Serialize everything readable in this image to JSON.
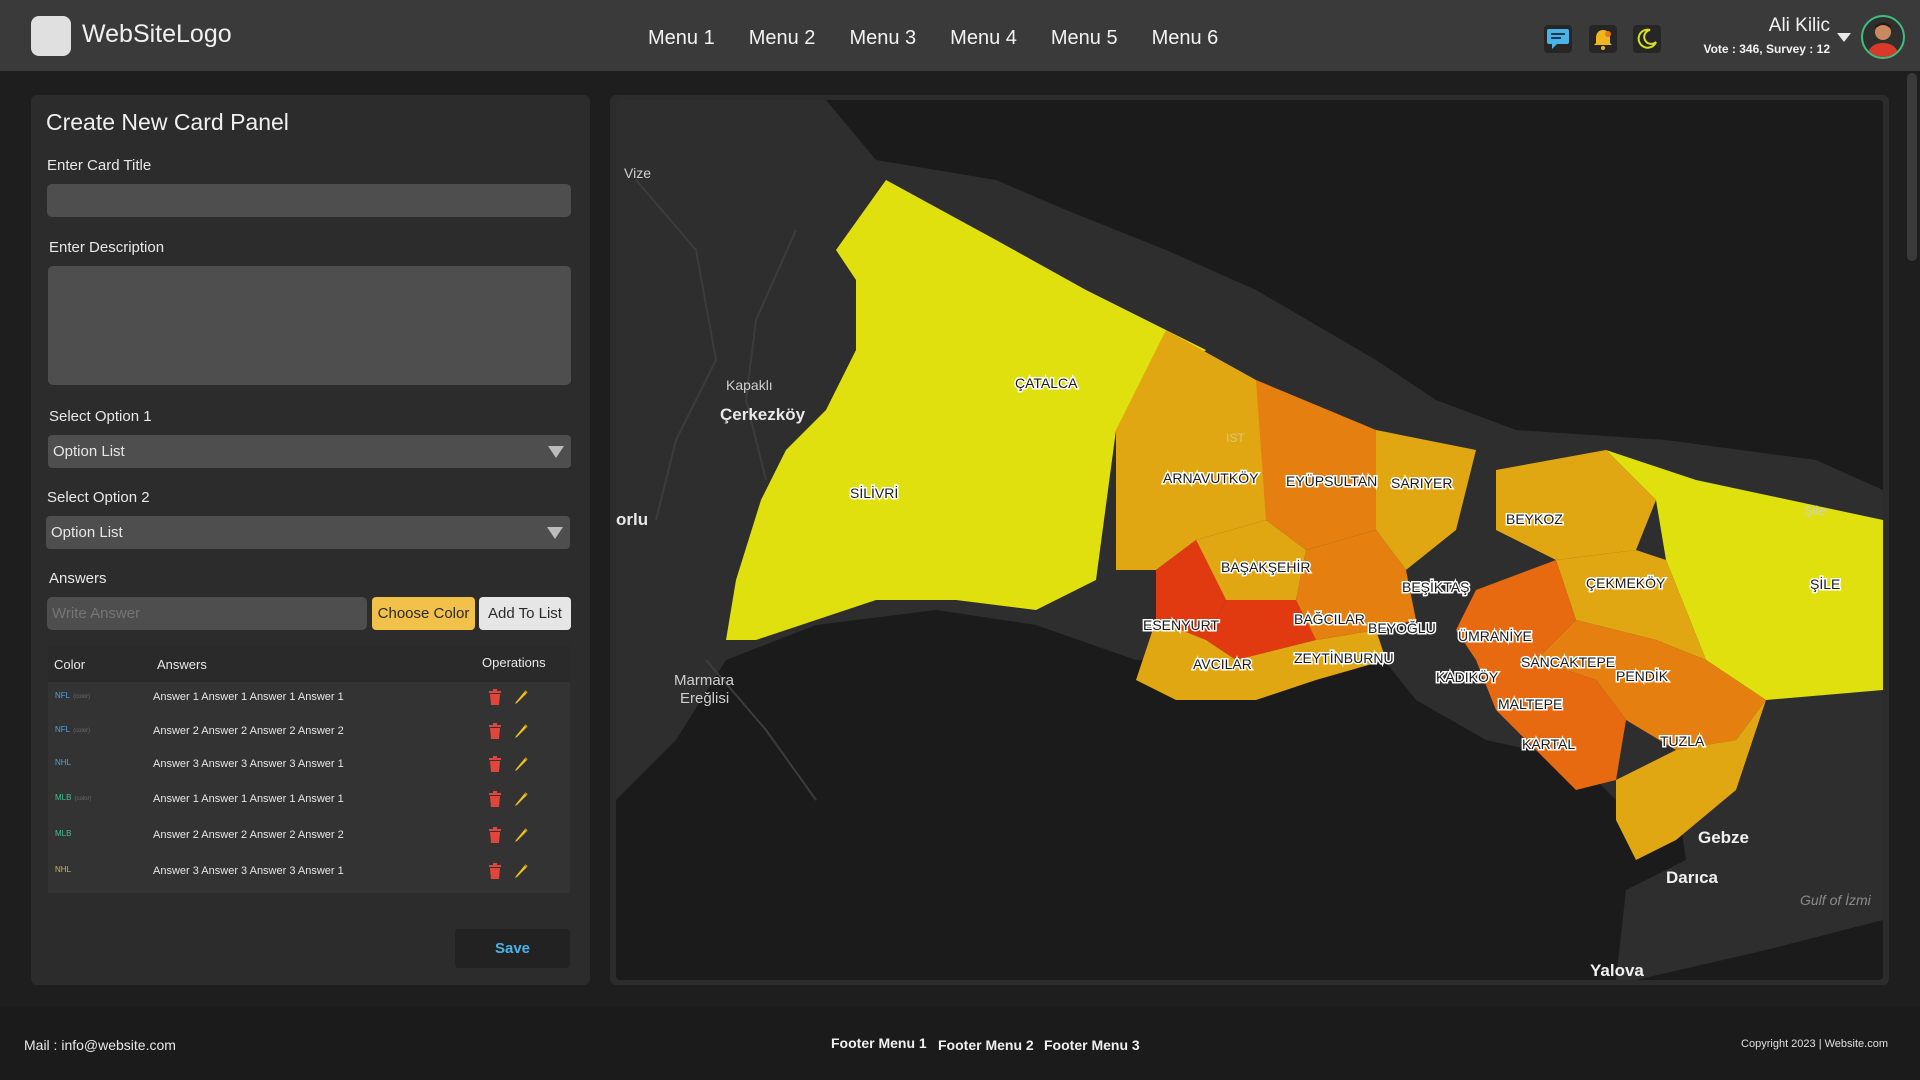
{
  "header": {
    "logo_text": "WebSiteLogo",
    "nav": [
      "Menu 1",
      "Menu 2",
      "Menu 3",
      "Menu 4",
      "Menu 5",
      "Menu 6"
    ],
    "icons": [
      "chat-icon",
      "bell-icon",
      "moon-icon"
    ],
    "user": {
      "name": "Ali Kilic",
      "stats": "Vote : 346, Survey : 12"
    }
  },
  "panel": {
    "title": "Create New Card Panel",
    "card_title_label": "Enter Card Title",
    "card_title_value": "",
    "description_label": "Enter Description",
    "description_value": "",
    "option1_label": "Select Option 1",
    "option1_value": "Option List",
    "option2_label": "Select Option 2",
    "option2_value": "Option List",
    "answers_label": "Answers",
    "answer_placeholder": "Write Answer",
    "choose_color_label": "Choose Color",
    "add_to_list_label": "Add To List",
    "table": {
      "headers": [
        "Color",
        "Answers",
        "Operations"
      ],
      "rows": [
        {
          "color_label": "NFL",
          "color_sub": "(color)",
          "color": "#4aa3d8",
          "answer": "Answer 1 Answer 1 Answer 1 Answer 1"
        },
        {
          "color_label": "NFL",
          "color_sub": "(color)",
          "color": "#4aa3d8",
          "answer": "Answer 2 Answer 2 Answer 2 Answer 2"
        },
        {
          "color_label": "NHL",
          "color_sub": "",
          "color": "#4aa3d8",
          "answer": "Answer 3 Answer 3 Answer 3 Answer 1"
        },
        {
          "color_label": "MLB",
          "color_sub": "(color)",
          "color": "#3fbf8f",
          "answer": "Answer 1 Answer 1 Answer 1 Answer 1"
        },
        {
          "color_label": "MLB",
          "color_sub": "",
          "color": "#3fbf8f",
          "answer": "Answer 2 Answer 2 Answer 2 Answer 2"
        },
        {
          "color_label": "NHL",
          "color_sub": "",
          "color": "#d8b04a",
          "answer": "Answer 3 Answer 3 Answer 3 Answer 1"
        }
      ]
    },
    "save_label": "Save"
  },
  "map": {
    "places": [
      "Vize",
      "Kapaklı",
      "Çerkezköy",
      "orlu",
      "Marmara",
      "Ereğlisi",
      "Gebze",
      "Darıca",
      "Yalova",
      "Gulf of İzmi",
      "IST",
      "Şile"
    ],
    "districts": [
      "ÇATALCA",
      "SİLİVRİ",
      "ARNAVUTKÖY",
      "EYÜPSULTAN",
      "SARIYER",
      "BEYKOZ",
      "BAŞAKŞEHİR",
      "BEŞİKTAŞ",
      "ÇEKMEKÖY",
      "ŞİLE",
      "ESENYURT",
      "BAĞCILAR",
      "BEYOĞLU",
      "ÜMRANİYE",
      "AVCILAR",
      "ZEYTİNBURNU",
      "SANCAKTEPE",
      "KADIKÖY",
      "PENDİK",
      "MALTEPE",
      "KARTAL",
      "TUZLA"
    ],
    "colors": {
      "yellow": "#dfe00e",
      "gold": "#e0a712",
      "orange": "#e57f10",
      "red": "#e23a10",
      "dark_orange": "#e86a10"
    }
  },
  "footer": {
    "mail": "Mail :  info@website.com",
    "menus": [
      "Footer Menu 1",
      "Footer Menu 2",
      "Footer Menu 3"
    ],
    "copyright": "Copyright 2023 | Website.com"
  }
}
